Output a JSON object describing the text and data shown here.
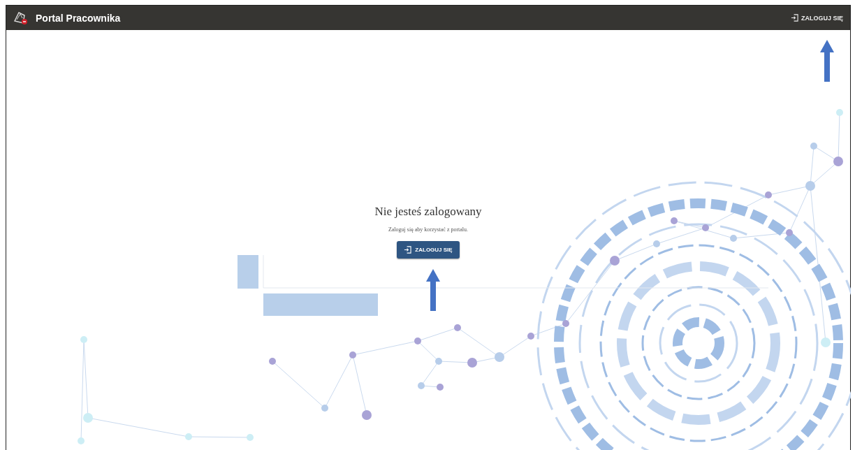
{
  "header": {
    "title": "Portal Pracownika",
    "login_button": "ZALOGUJ SIĘ"
  },
  "main": {
    "heading": "Nie jesteś zalogowany",
    "message": "Zaloguj się aby korzystać z portalu.",
    "login_button": "ZALOGUJ SIĘ"
  }
}
